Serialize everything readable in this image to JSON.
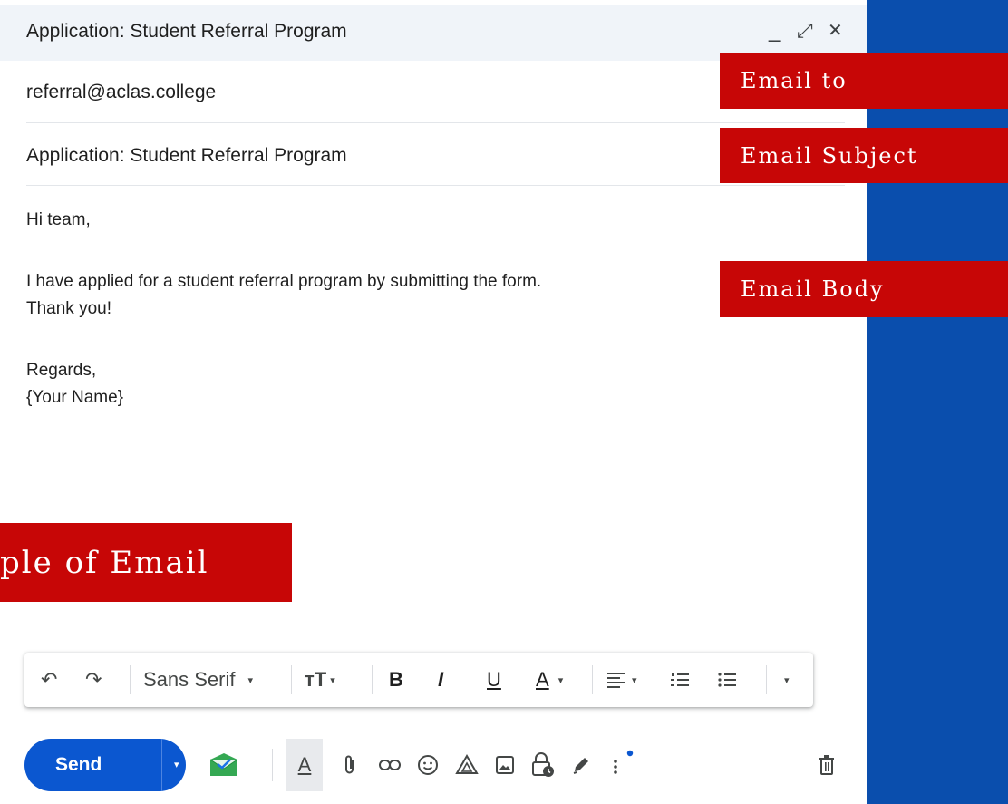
{
  "window": {
    "title": "Application: Student Referral Program",
    "minimize": "_",
    "expand": "⤢",
    "close": "✕"
  },
  "compose": {
    "to": "referral@aclas.college",
    "subject": "Application: Student Referral Program",
    "body_lines": [
      "Hi team,",
      "I have applied for a student referral program by submitting the form.",
      "Thank you!",
      "Regards,",
      "{Your Name}"
    ]
  },
  "callouts": {
    "email_to": "Email to",
    "email_subject": "Email Subject",
    "email_body": "Email Body",
    "sample": "ple of Email"
  },
  "toolbar": {
    "undo": "↶",
    "redo": "↷",
    "font": "Sans Serif",
    "size": "тT",
    "bold": "B",
    "italic": "I",
    "underline": "U",
    "text_color": "A",
    "caret": "▾"
  },
  "actions": {
    "send_label": "Send"
  },
  "colors": {
    "background": "#0a4ead",
    "callout": "#c70606",
    "send_button": "#0b57d0"
  }
}
